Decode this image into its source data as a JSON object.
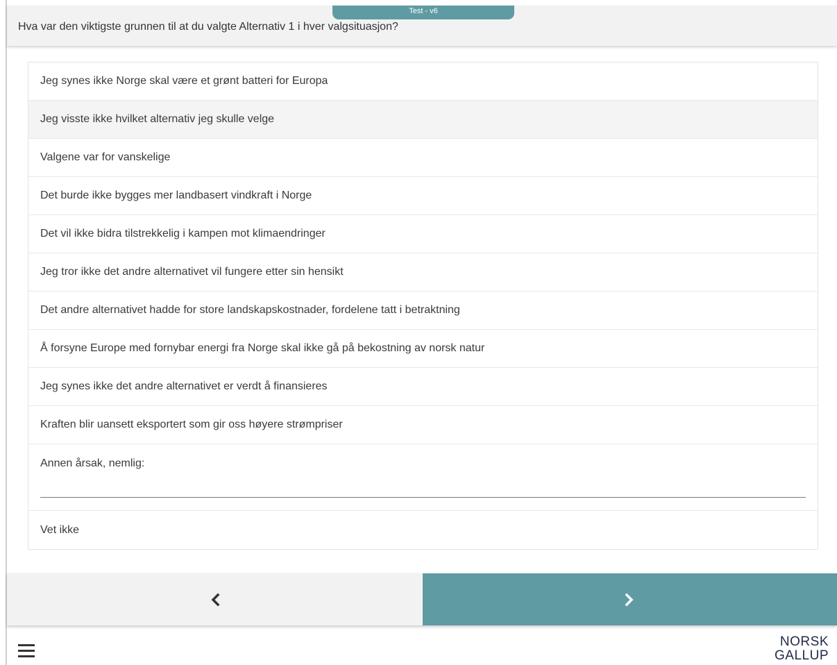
{
  "header": {
    "version_tab": "Test - v6",
    "question": "Hva var den viktigste grunnen til at du valgte Alternativ 1 i hver valgsituasjon?"
  },
  "answers": [
    "Jeg synes ikke Norge skal være et grønt batteri for Europa",
    "Jeg visste ikke hvilket alternativ jeg skulle velge",
    "Valgene var for vanskelige",
    "Det burde ikke bygges mer landbasert vindkraft i Norge",
    "Det vil ikke bidra tilstrekkelig i kampen mot klimaendringer",
    "Jeg tror ikke det andre alternativet vil fungere etter sin hensikt",
    "Det andre alternativet hadde for store landskapskostnader, fordelene tatt i betraktning",
    "Å forsyne Europe med fornybar energi fra Norge skal ikke gå på bekostning av norsk natur",
    "Jeg synes ikke det andre alternativet er verdt å finansieres",
    "Kraften blir uansett eksportert som gir oss høyere strømpriser"
  ],
  "other_option": {
    "label": "Annen årsak, nemlig:",
    "value": "",
    "placeholder": ""
  },
  "dont_know": "Vet ikke",
  "navigation": {
    "back_icon": "chevron-left-icon",
    "next_icon": "chevron-right-icon"
  },
  "footer": {
    "menu_icon": "hamburger-menu-icon",
    "logo_line1": "NORSK",
    "logo_line2": "GALLUP"
  },
  "colors": {
    "accent": "#5f9ba3",
    "header_bg": "#f2f2f2",
    "logo": "#1f2a44"
  }
}
